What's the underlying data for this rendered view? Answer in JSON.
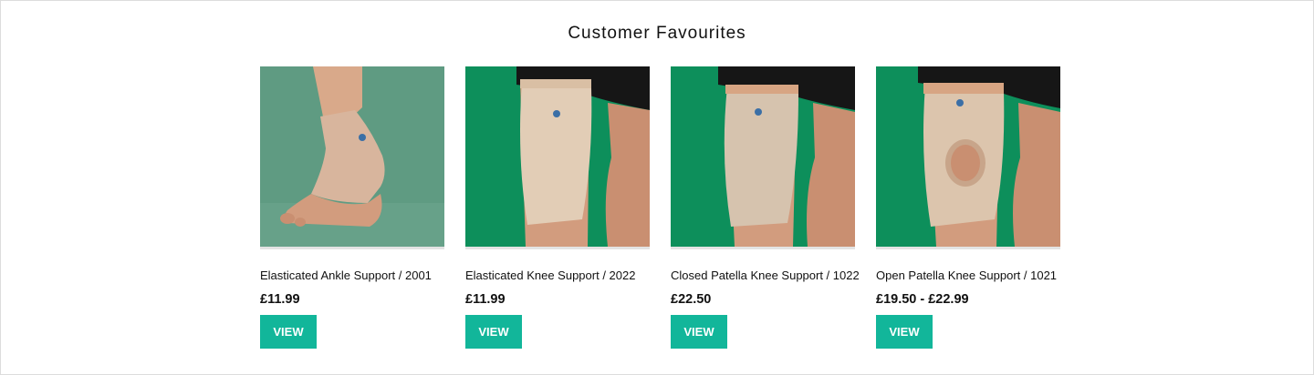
{
  "section": {
    "title": "Customer Favourites"
  },
  "products": [
    {
      "name": "Elasticated Ankle Support / 2001",
      "price": "£11.99",
      "button": "VIEW",
      "image": "ankle-support-image"
    },
    {
      "name": "Elasticated Knee Support / 2022",
      "price": "£11.99",
      "button": "VIEW",
      "image": "knee-support-image"
    },
    {
      "name": "Closed Patella Knee Support / 1022",
      "price": "£22.50",
      "button": "VIEW",
      "image": "closed-patella-knee-support-image"
    },
    {
      "name": "Open Patella Knee Support / 1021",
      "price": "£19.50 - £22.99",
      "button": "VIEW",
      "image": "open-patella-knee-support-image"
    }
  ],
  "colors": {
    "accent": "#12b69a",
    "image_background_green": "#0d8f5b",
    "image_background_sage": "#5f9b82",
    "support_beige": "#dcc5ad"
  }
}
